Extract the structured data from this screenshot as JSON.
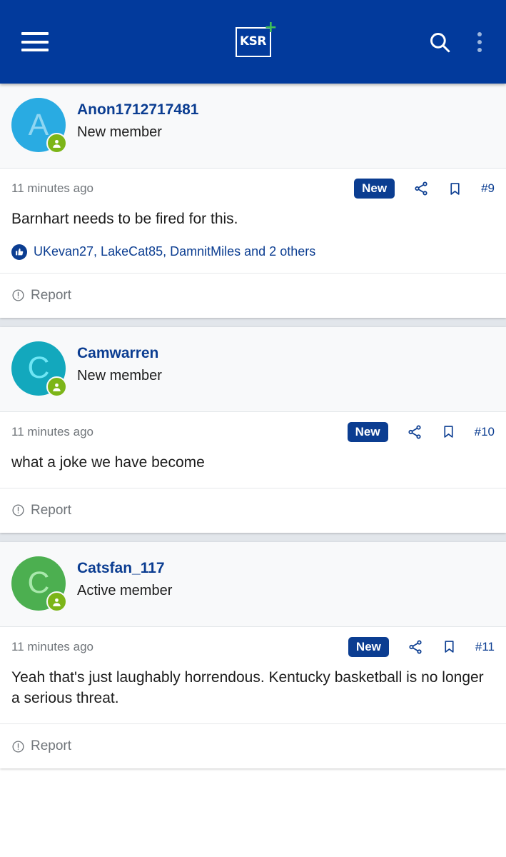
{
  "header": {
    "menu_label": "menu",
    "logo_text": "KSR",
    "logo_plus": "+",
    "search_label": "Search",
    "overflow_label": "More options",
    "bg_color": "#023a9c",
    "plus_color": "#3fbf58"
  },
  "posts": [
    {
      "avatar_letter": "A",
      "avatar_color": "#29abe2",
      "avatar_letter_color": "#8fd6f2",
      "username": "Anon1712717481",
      "user_title": "New member",
      "timestamp": "11 minutes ago",
      "new_label": "New",
      "post_number": "#9",
      "body": "Barnhart needs to be fired for this.",
      "likes_text": "UKevan27, LakeCat85, DamnitMiles and 2 others",
      "report_label": "Report"
    },
    {
      "avatar_letter": "C",
      "avatar_color": "#13a8bd",
      "avatar_letter_color": "#6fe6f5",
      "username": "Camwarren",
      "user_title": "New member",
      "timestamp": "11 minutes ago",
      "new_label": "New",
      "post_number": "#10",
      "body": "what a joke we have become",
      "likes_text": "",
      "report_label": "Report"
    },
    {
      "avatar_letter": "C",
      "avatar_color": "#4caf50",
      "avatar_letter_color": "#a9e8ac",
      "username": "Catsfan_117",
      "user_title": "Active member",
      "timestamp": "11 minutes ago",
      "new_label": "New",
      "post_number": "#11",
      "body": "Yeah that's just laughably horrendous. Kentucky basketball is no longer a serious threat.",
      "likes_text": "",
      "report_label": "Report"
    }
  ],
  "icons": {
    "share": "share-icon",
    "bookmark": "bookmark-icon",
    "report": "report-icon",
    "like": "thumbs-up-icon",
    "online_badge": "online-status-icon"
  }
}
